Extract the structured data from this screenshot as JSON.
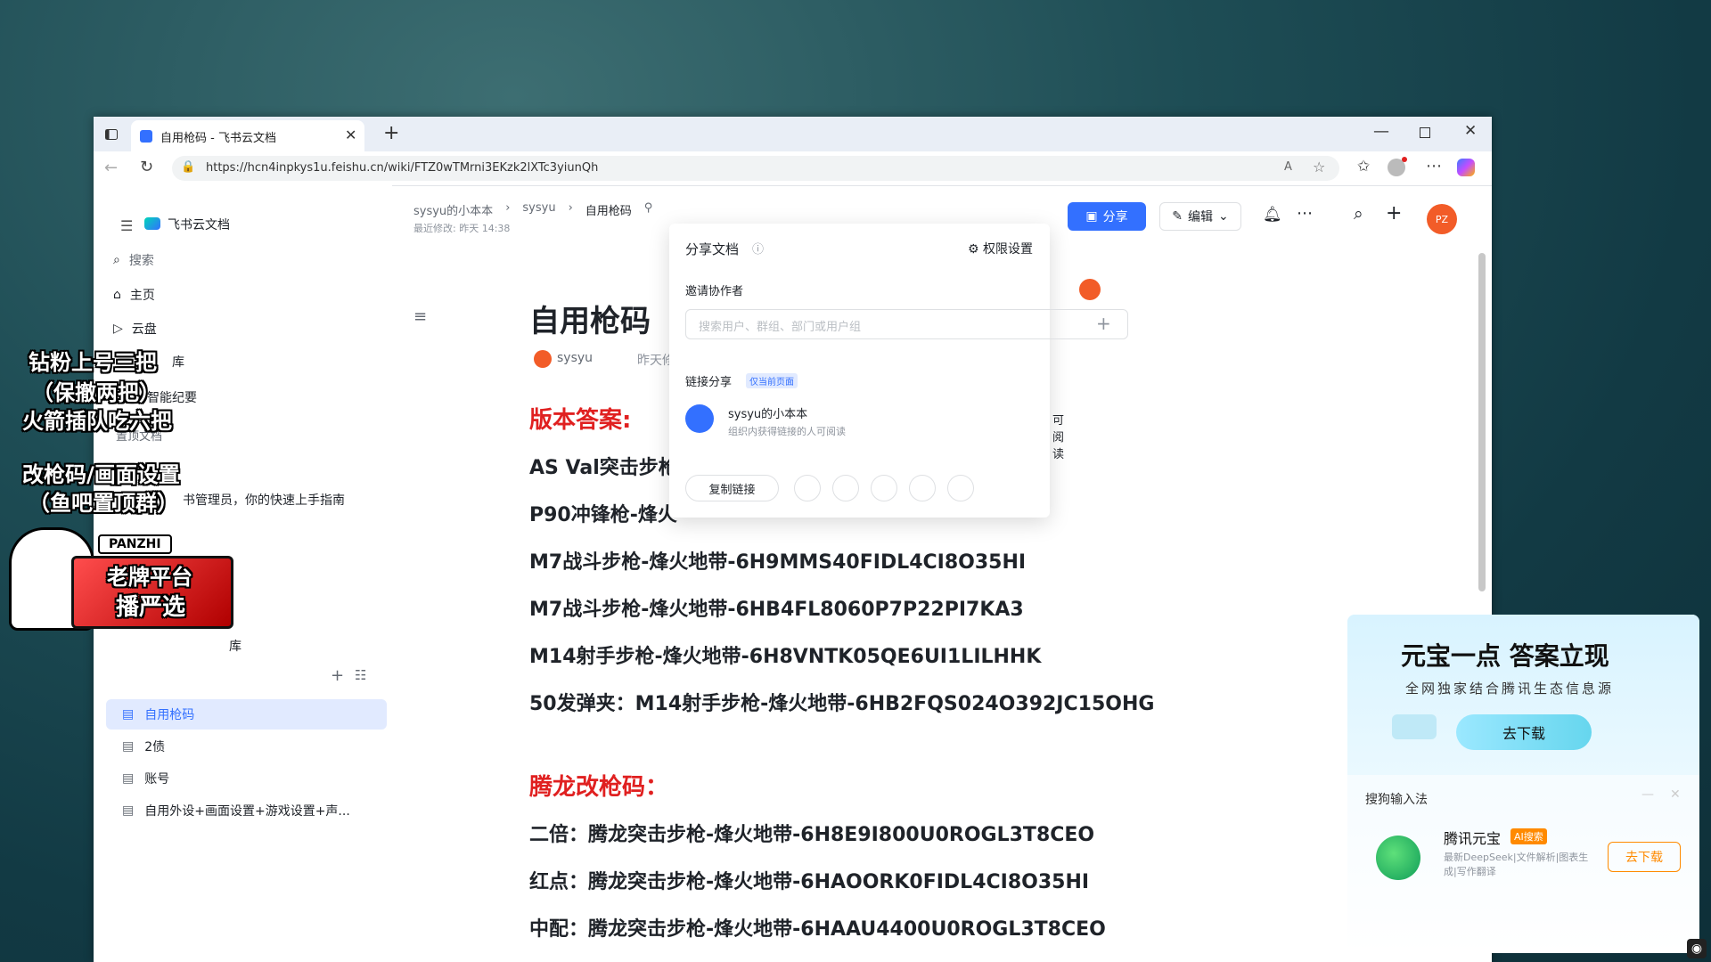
{
  "browser": {
    "tab_title": "自用枪码 - 飞书云文档",
    "url": "https://hcn4inpkys1u.feishu.cn/wiki/FTZ0wTMrni3EKzk2lXTc3yiunQh"
  },
  "app": {
    "name": "飞书云文档",
    "search": "搜索",
    "nav": [
      "主页",
      "云盘"
    ],
    "tree_items": [
      "自用枪码",
      "2债",
      "账号",
      "自用外设+画面设置+游戏设置+声..."
    ],
    "partial_text": {
      "library": "库",
      "minutes": "智能纪要",
      "pinned": "置顶文档",
      "guide": "书管理员，你的快速上手指南",
      "library2": "库"
    }
  },
  "header": {
    "breadcrumb": [
      "sysyu的小本本",
      "sysyu",
      "自用枪码"
    ],
    "last_modified": "最近修改: 昨天 14:38",
    "share_label": "分享",
    "edit_label": "编辑",
    "avatar_initials": "PZ"
  },
  "doc": {
    "title": "自用枪码",
    "author": "sysyu",
    "date_partial": "昨天修",
    "section1": "版本答案:",
    "lines1": [
      "AS Val突击步枪",
      "P90冲锋枪-烽火",
      "M7战斗步枪-烽火地带-6H9MMS40FIDL4CI8O35HI",
      "M7战斗步枪-烽火地带-6HB4FL8060P7P22PI7KA3",
      "M14射手步枪-烽火地带-6H8VNTK05QE6UI1LILHHK",
      "50发弹夹：M14射手步枪-烽火地带-6HB2FQS024O392JC15OHG"
    ],
    "section2": "腾龙改枪码：",
    "lines2": [
      "二倍：腾龙突击步枪-烽火地带-6H8E9I800U0ROGL3T8CEO",
      "红点：腾龙突击步枪-烽火地带-6HAOORK0FIDL4CI8O35HI",
      "中配：腾龙突击步枪-烽火地带-6HAAU4400U0ROGL3T8CEO"
    ]
  },
  "share_popover": {
    "title": "分享文档",
    "permissions": "权限设置",
    "invite": "邀请协作者",
    "search_placeholder": "搜索用户、群组、部门或用户组",
    "link_share": "链接分享",
    "link_badge": "仅当前页面",
    "org_name": "sysyu的小本本",
    "org_desc": "组织内获得链接的人可阅读",
    "access": "可阅读",
    "copy_link": "复制链接"
  },
  "overlay_text": {
    "line1": "钻粉上号三把",
    "line2": "（保撤两把）",
    "line3": "火箭插队吃六把",
    "line4": "改枪码/画面设置",
    "line5": "（鱼吧置顶群）",
    "badge_brand": "PANZHI",
    "badge_line1": "老牌平台",
    "badge_line2": "播严选"
  },
  "ad": {
    "headline": "元宝一点 答案立现",
    "subline": "全网独家结合腾讯生态信息源",
    "cta": "去下载",
    "source": "搜狗输入法",
    "app_name": "腾讯元宝",
    "app_badge": "AI搜索",
    "app_desc": "最新DeepSeek|文件解析|图表生成|写作翻译",
    "app_cta": "去下载"
  },
  "colors": {
    "accent": "#3370ff",
    "red": "#e02020",
    "avatar": "#f25c28"
  }
}
